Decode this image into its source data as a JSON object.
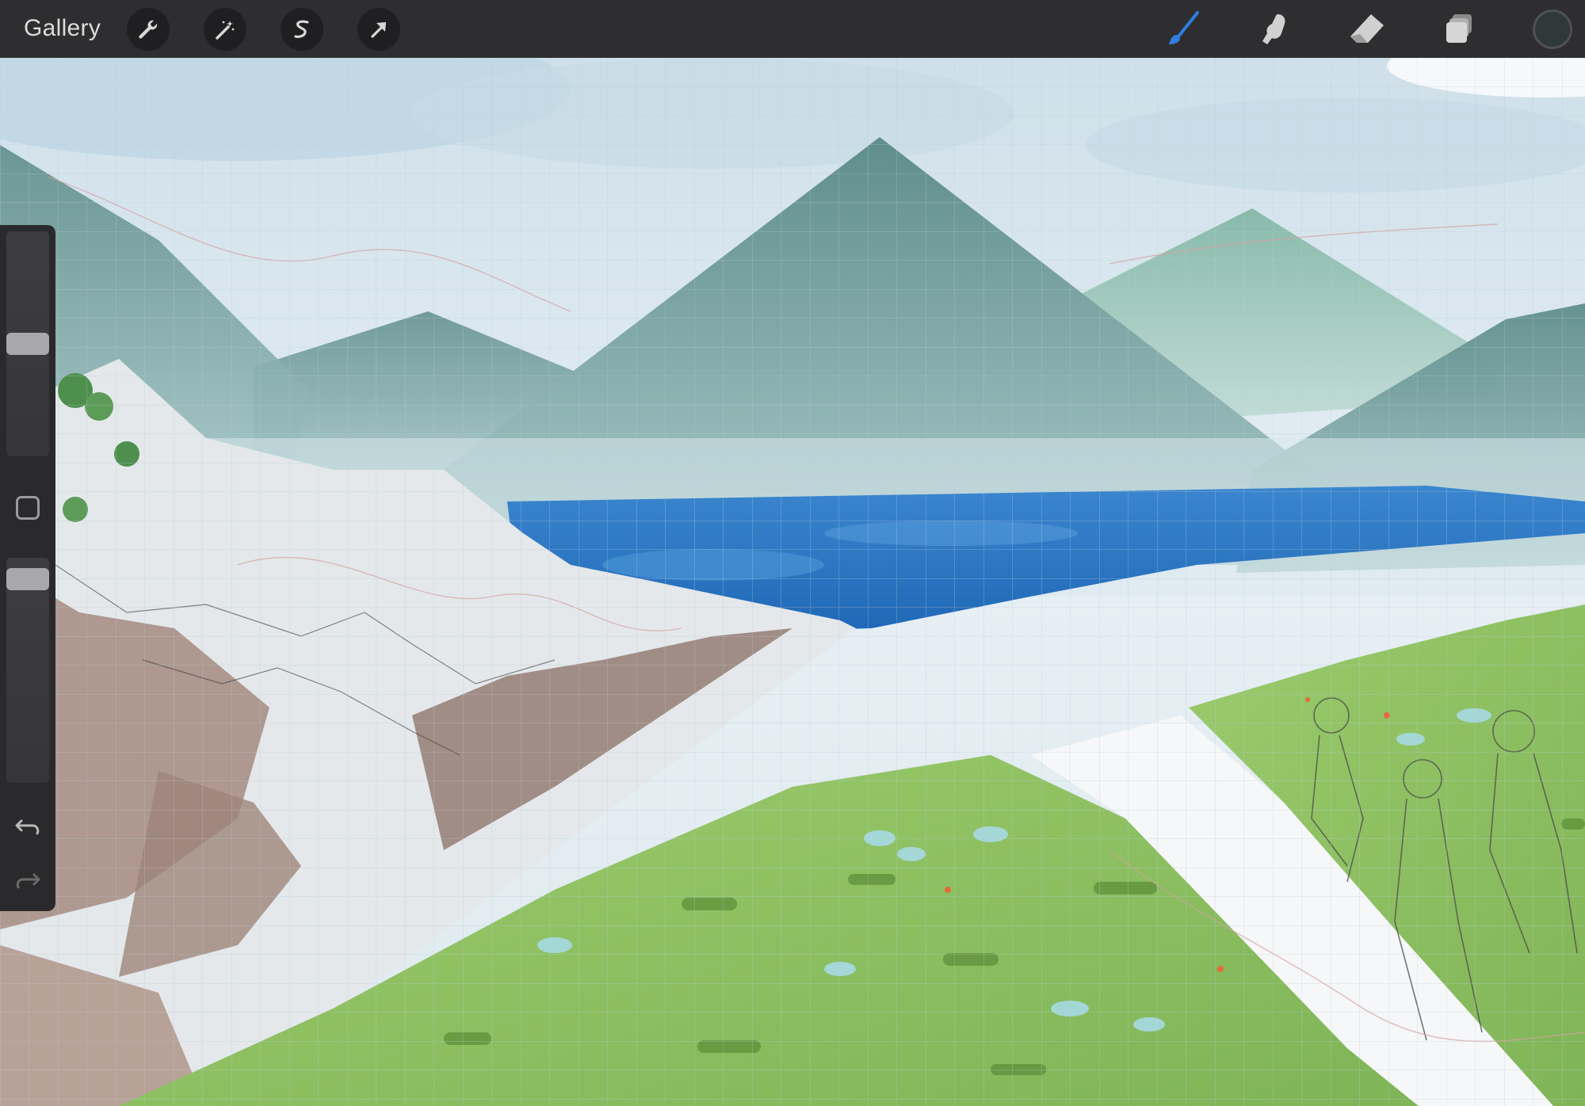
{
  "toolbar": {
    "gallery_label": "Gallery",
    "left_tools": [
      {
        "name": "actions",
        "icon": "wrench-icon"
      },
      {
        "name": "adjustments",
        "icon": "magic-wand-icon"
      },
      {
        "name": "selection",
        "icon": "selection-s-icon"
      },
      {
        "name": "transform",
        "icon": "arrow-cursor-icon"
      }
    ],
    "right_tools": [
      {
        "name": "brush",
        "icon": "brush-icon",
        "active": true
      },
      {
        "name": "smudge",
        "icon": "smudge-finger-icon",
        "active": false
      },
      {
        "name": "eraser",
        "icon": "eraser-icon",
        "active": false
      },
      {
        "name": "layers",
        "icon": "layers-icon",
        "active": false
      }
    ],
    "current_color": "#2f3a38"
  },
  "sidebar": {
    "brush_size_level": 0.5,
    "brush_opacity_level": 0.95,
    "modifier_icon": "square-modifier-icon",
    "undo_icon": "undo-icon",
    "redo_icon": "redo-icon"
  },
  "colors": {
    "toolbar_bg": "#2e2e30",
    "active_brush": "#2f7fe0",
    "icon_light": "#d8d8d8",
    "sky": "#e9f1f5",
    "mountain": "#6e9c98",
    "sea": "#2d7ac4",
    "grass": "#8cc063",
    "path": "#f6f7f8",
    "rock": "#9a8378"
  }
}
